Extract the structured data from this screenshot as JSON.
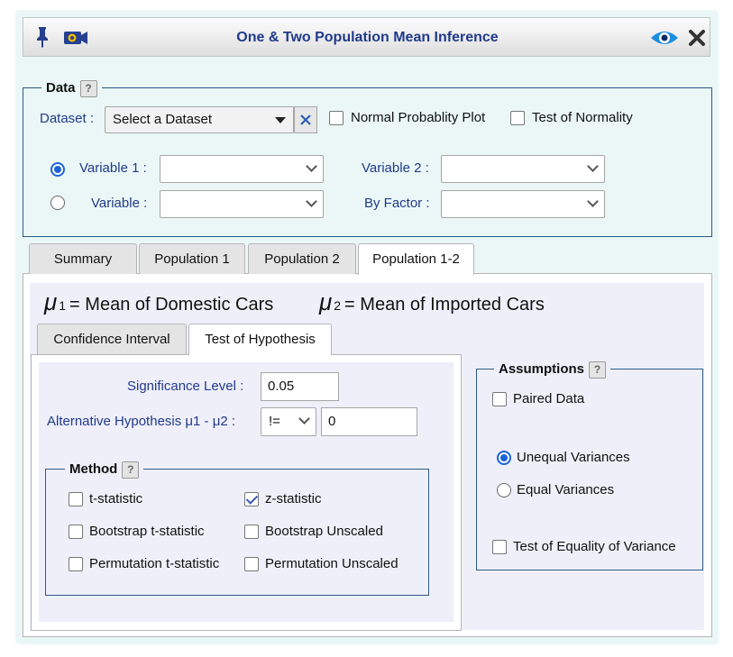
{
  "window": {
    "title": "One & Two Population Mean Inference"
  },
  "data_section": {
    "legend": "Data",
    "dataset_label": "Dataset :",
    "dataset_value": "Select a Dataset",
    "normal_plot_label": "Normal Probablity Plot",
    "normality_test_label": "Test of Normality",
    "variable1_label": "Variable 1 :",
    "variable2_label": "Variable 2 :",
    "variable_label": "Variable :",
    "by_factor_label": "By Factor :"
  },
  "tabs": [
    "Summary",
    "Population 1",
    "Population 2",
    "Population 1-2"
  ],
  "active_tab": 3,
  "means": {
    "mu_symbol": "μ",
    "mu1_sub": "1",
    "mu1_text": "= Mean of Domestic Cars",
    "mu2_sub": "2",
    "mu2_text": "= Mean of Imported Cars"
  },
  "subtabs": [
    "Confidence Interval",
    "Test of Hypothesis"
  ],
  "hypothesis": {
    "significance_label": "Significance Level :",
    "significance_value": "0.05",
    "alt_label": "Alternative Hypothesis μ1 - μ2 :",
    "alt_operator": "!=",
    "alt_value": "0"
  },
  "method": {
    "legend": "Method",
    "t_statistic": "t-statistic",
    "z_statistic": "z-statistic",
    "bootstrap_t": "Bootstrap t-statistic",
    "bootstrap_unscaled": "Bootstrap Unscaled",
    "permutation_t": "Permutation t-statistic",
    "permutation_unscaled": "Permutation Unscaled"
  },
  "assumptions": {
    "legend": "Assumptions",
    "paired": "Paired Data",
    "unequal": "Unequal Variances",
    "equal": "Equal Variances",
    "equality_test": "Test of Equality of Variance"
  },
  "help_glyph": "?",
  "colors": {
    "label_blue": "#213a8a",
    "radio_blue": "#1a63d6",
    "panel_bg": "#eaf7f6",
    "content_bg": "#efeff9"
  },
  "icons": [
    "pin-icon",
    "camera-icon",
    "eye-icon",
    "close-icon",
    "clear-icon",
    "help-icon"
  ]
}
